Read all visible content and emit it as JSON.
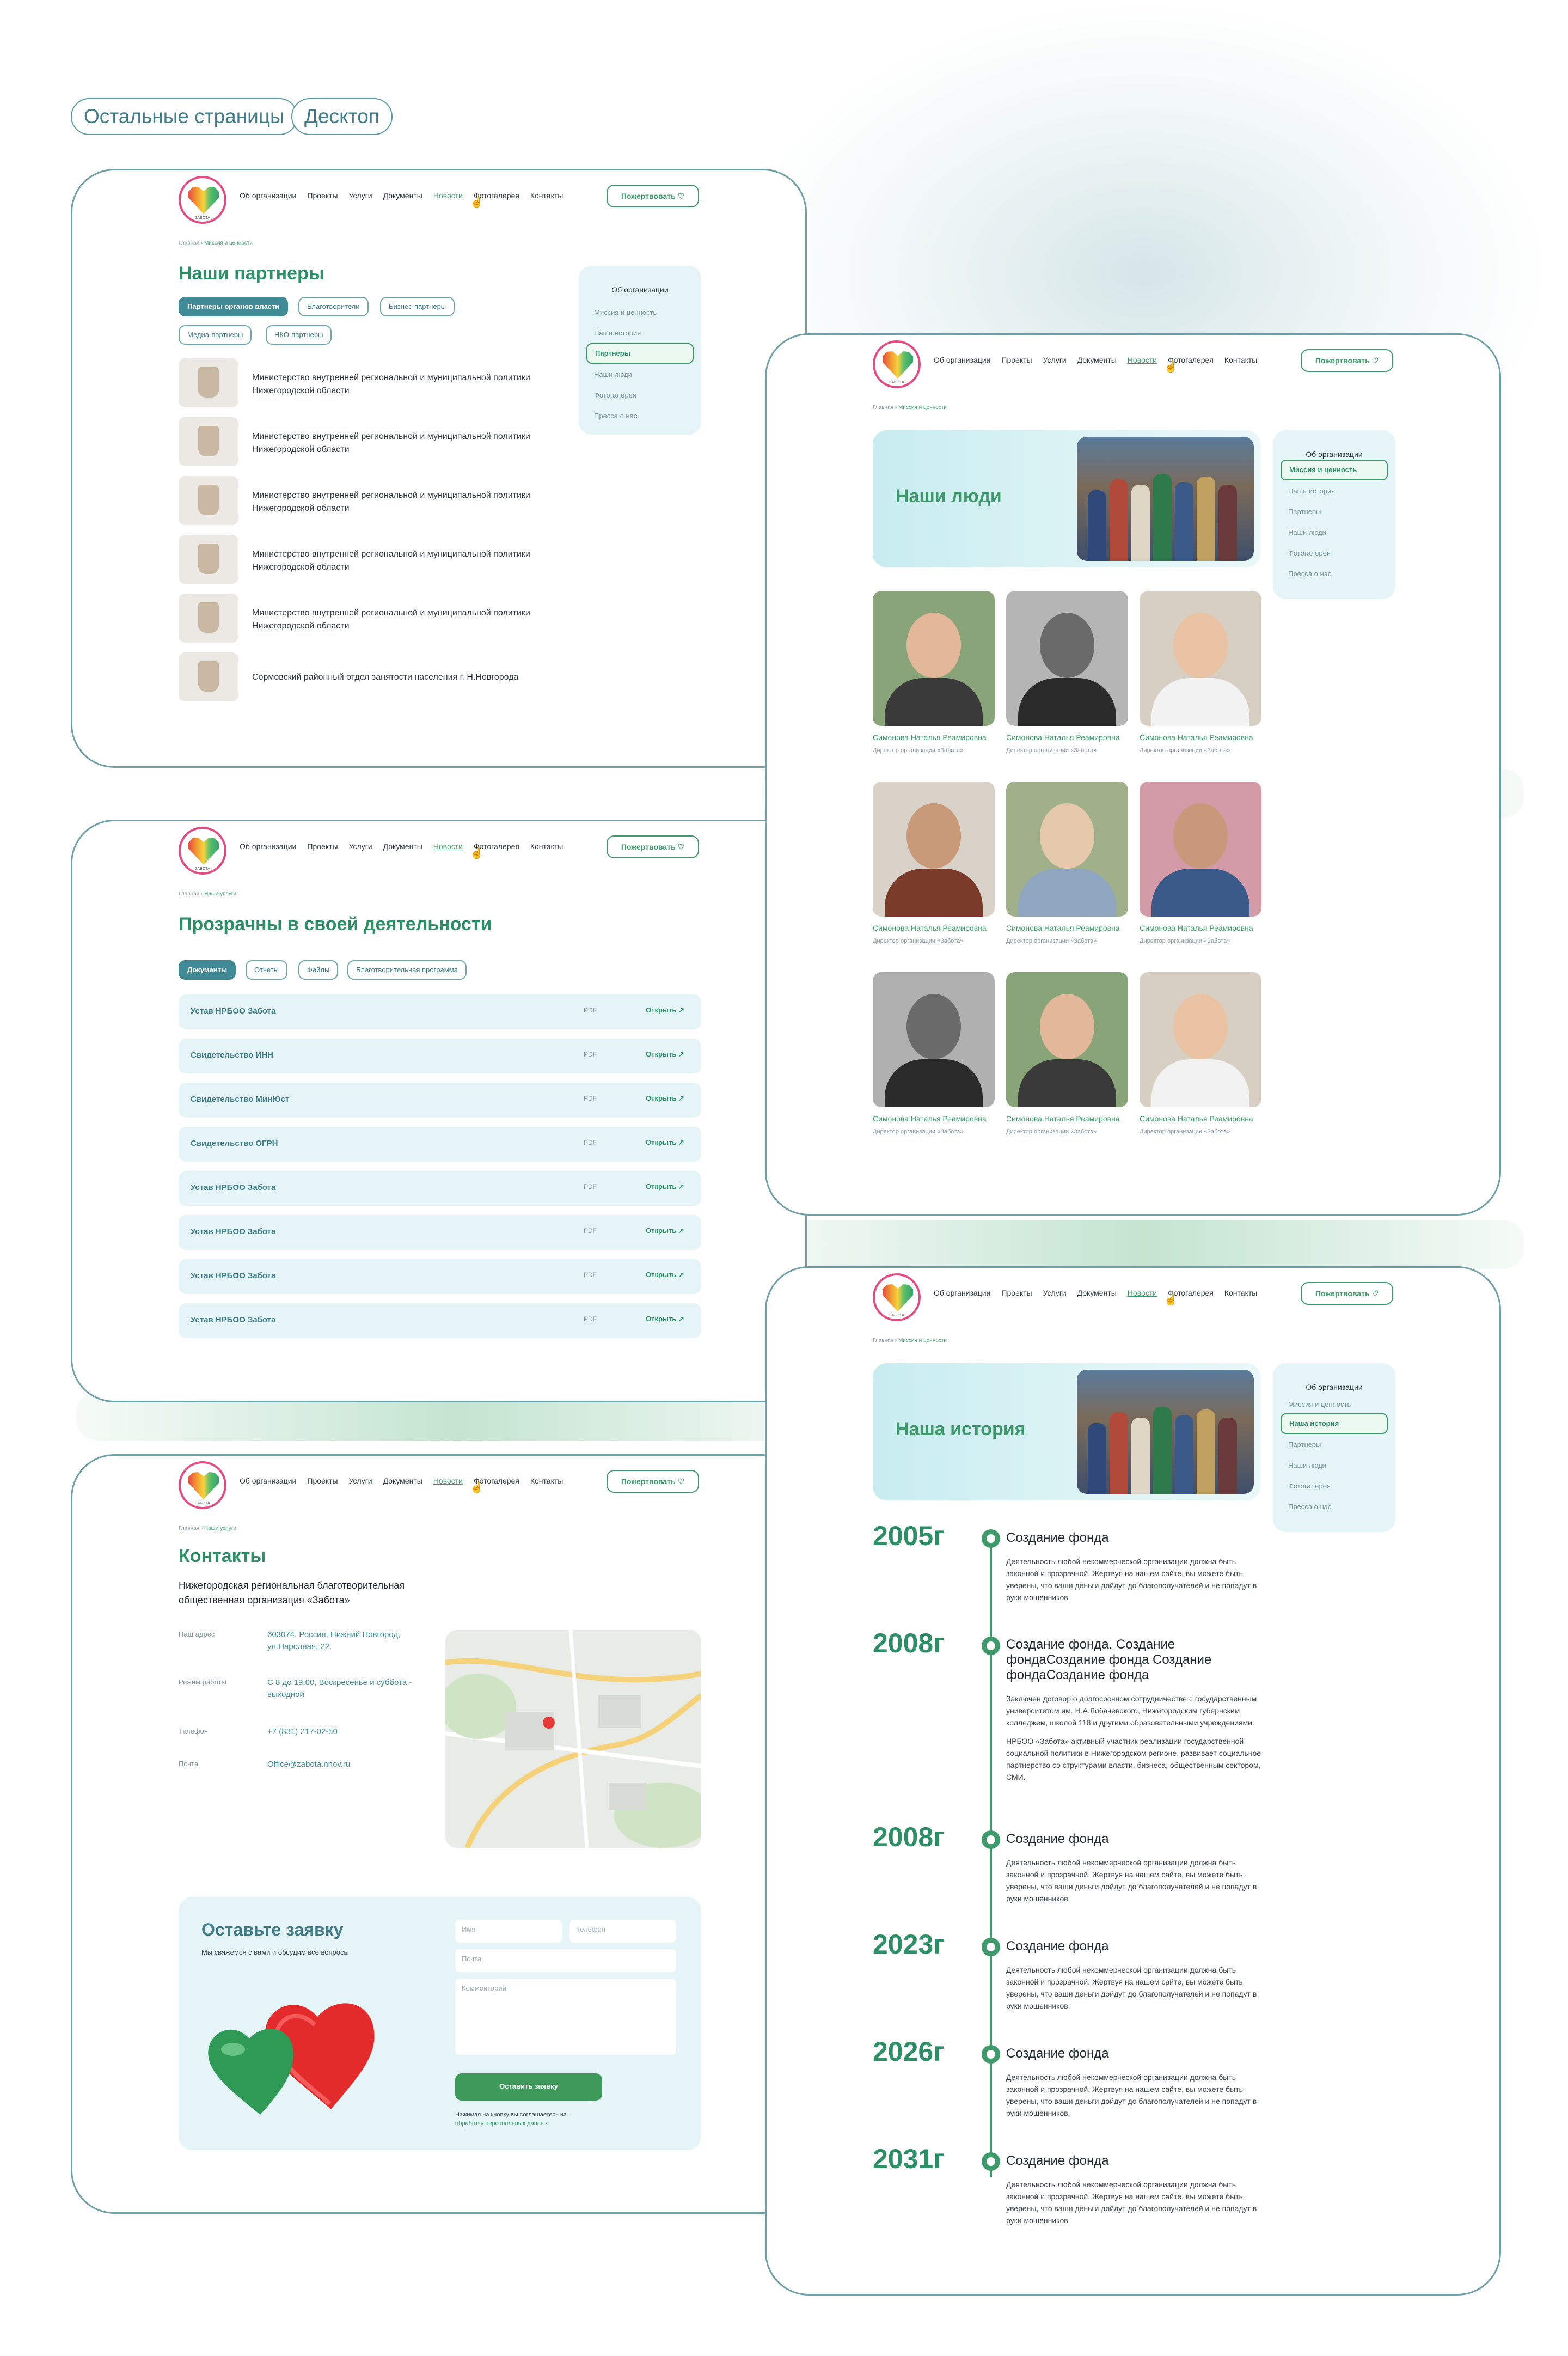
{
  "labels": {
    "pages": "Остальные страницы",
    "device": "Десктоп"
  },
  "header": {
    "logo_text": "ЗАБОТА",
    "nav": [
      "Об организации",
      "Проекты",
      "Услуги",
      "Документы",
      "Новости",
      "Фотогалерея",
      "Контакты"
    ],
    "donate": "Пожертвовать"
  },
  "partners_page": {
    "breadcrumb_home": "Главная",
    "breadcrumb_current": "Миссия и ценности",
    "title": "Наши партнеры",
    "filters": [
      "Партнеры органов власти",
      "Благотворители",
      "Бизнес-партнеры",
      "Медиа-партнеры",
      "НКО-партнеры"
    ],
    "items": [
      "Министерство внутренней региональной и муниципальной политики Нижегородской области",
      "Министерство внутренней региональной и муниципальной политики Нижегородской области",
      "Министерство внутренней региональной и муниципальной политики Нижегородской области",
      "Министерство внутренней региональной и муниципальной политики Нижегородской области",
      "Министерство внутренней региональной и муниципальной политики Нижегородской области",
      "Сормовский районный отдел занятости населения г. Н.Новгорода"
    ],
    "side_active": "Партнеры"
  },
  "sidebar": {
    "title": "Об организации",
    "items": [
      "Миссия и ценность",
      "Наша история",
      "Партнеры",
      "Наши люди",
      "Фотогалерея",
      "Пресса о нас"
    ]
  },
  "documents_page": {
    "breadcrumb_home": "Главная",
    "breadcrumb_current": "Наши услуги",
    "title": "Прозрачны в своей деятельности",
    "tabs": [
      "Документы",
      "Отчеты",
      "Файлы",
      "Благотворительная программа"
    ],
    "docs": [
      "Устав НРБОО Забота",
      "Свидетельство ИНН",
      "Свидетельство МинЮст",
      "Свидетельство ОГРН",
      "Устав НРБОО Забота",
      "Устав НРБОО Забота",
      "Устав НРБОО Забота",
      "Устав НРБОО Забота"
    ],
    "format": "PDF",
    "open": "Открыть ↗"
  },
  "contacts_page": {
    "breadcrumb_home": "Главная",
    "breadcrumb_current": "Наши услуги",
    "title": "Контакты",
    "subtitle": "Нижегородская региональная благотворительная общественная организация «Забота»",
    "rows": [
      {
        "label": "Наш адрес",
        "value": "603074, Россия, Нижний Новгород, ул.Народная, 22."
      },
      {
        "label": "Режим работы",
        "value": "С 8 до 19:00, Воскресенье и суббота - выходной"
      },
      {
        "label": "Телефон",
        "value": "+7 (831) 217-02-50"
      },
      {
        "label": "Почта",
        "value": "Office@zabota.nnov.ru"
      }
    ],
    "form": {
      "title": "Оставьте заявку",
      "subtitle": "Мы свяжемся с вами и обсудим все вопросы",
      "name": "Имя",
      "phone": "Телефон",
      "email": "Почта",
      "comment": "Комментарий",
      "submit": "Оставить заявку",
      "consent": "Нажимая на кнопку вы соглашаетесь на",
      "consent_link": "обработку персональных данных"
    }
  },
  "people_page": {
    "breadcrumb_home": "Главная",
    "breadcrumb_current": "Миссия и ценности",
    "title": "Наши люди",
    "side_active": "Миссия и ценность",
    "person_name": "Симонова Наталья Реамировна",
    "person_role": "Директор организации «Забота»"
  },
  "history_page": {
    "breadcrumb_home": "Главная",
    "breadcrumb_current": "Миссия и ценности",
    "title": "Наша история",
    "side_active": "Наша история",
    "events": [
      {
        "year": "2005г",
        "title": "Создание фонда",
        "text": [
          "Деятельность любой некоммерческой организации должна быть законной и прозрачной. Жертвуя на нашем сайте, вы можете быть уверены, что ваши деньги дойдут до благополучателей и не попадут в руки мошенников."
        ]
      },
      {
        "year": "2008г",
        "title": "Создание фонда. Создание фондаСоздание фонда Создание фондаСоздание фонда",
        "text": [
          "Заключен договор о долгосрочном сотрудничестве с государственным университетом им. Н.А.Лобачевского, Нижегородским губернским колледжем, школой 118 и другими образовательными учреждениями.",
          "НРБОО «Забота» активный участник реализации государственной социальной политики в Нижегородском регионе, развивает социальное партнерство со структурами власти, бизнеса, общественным сектором, СМИ."
        ]
      },
      {
        "year": "2008г",
        "title": "Создание фонда",
        "text": [
          "Деятельность любой некоммерческой организации должна быть законной и прозрачной. Жертвуя на нашем сайте, вы можете быть уверены, что ваши деньги дойдут до благополучателей и не попадут в руки мошенников."
        ]
      },
      {
        "year": "2023г",
        "title": "Создание фонда",
        "text": [
          "Деятельность любой некоммерческой организации должна быть законной и прозрачной. Жертвуя на нашем сайте, вы можете быть уверены, что ваши деньги дойдут до благополучателей и не попадут в руки мошенников."
        ]
      },
      {
        "year": "2026г",
        "title": "Создание фонда",
        "text": [
          "Деятельность любой некоммерческой организации должна быть законной и прозрачной. Жертвуя на нашем сайте, вы можете быть уверены, что ваши деньги дойдут до благополучателей и не попадут в руки мошенников."
        ]
      },
      {
        "year": "2031г",
        "title": "Создание фонда",
        "text": [
          "Деятельность любой некоммерческой организации должна быть законной и прозрачной. Жертвуя на нашем сайте, вы можете быть уверены, что ваши деньги дойдут до благополучателей и не попадут в руки мошенников."
        ]
      }
    ]
  },
  "colors": {
    "brand_green": "#2d8f65",
    "teal": "#3f8a95",
    "light_panel": "#e4f4f7",
    "card_border": "#6f9fa8"
  }
}
